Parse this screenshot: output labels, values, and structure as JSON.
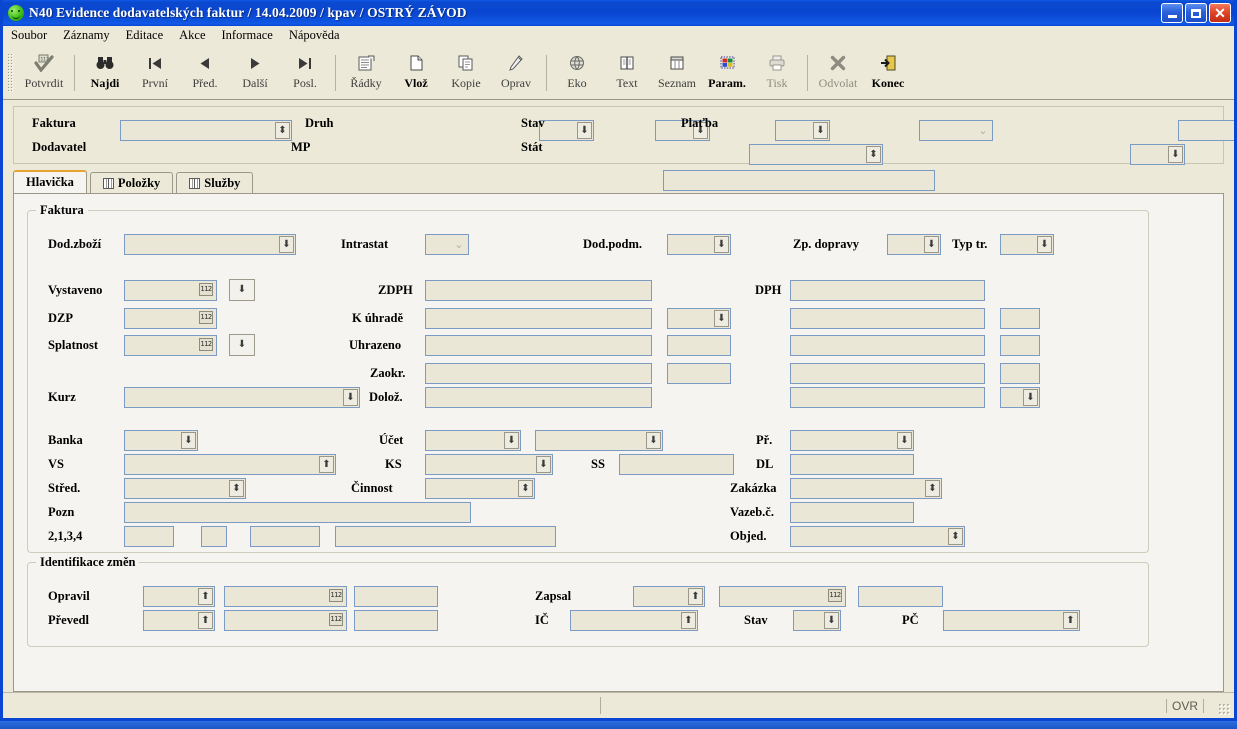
{
  "window": {
    "title": "N40 Evidence dodavatelských faktur / 14.04.2009 / kpav / OSTRÝ ZÁVOD",
    "icon": "smiley-icon",
    "minimize_label": "_",
    "maximize_label": "□",
    "close_label": "✕"
  },
  "menu": {
    "items": [
      {
        "label": "Soubor"
      },
      {
        "label": "Záznamy"
      },
      {
        "label": "Editace"
      },
      {
        "label": "Akce"
      },
      {
        "label": "Informace"
      },
      {
        "label": "Nápověda"
      }
    ]
  },
  "toolbar": {
    "items": [
      {
        "label": "Potvrdit",
        "icon": "check-stamp-icon",
        "state": "normal"
      },
      {
        "label": "Najdi",
        "icon": "binoculars-icon",
        "state": "bold"
      },
      {
        "label": "První",
        "icon": "first-record-icon",
        "state": "normal"
      },
      {
        "label": "Před.",
        "icon": "previous-record-icon",
        "state": "normal"
      },
      {
        "label": "Další",
        "icon": "next-record-icon",
        "state": "normal"
      },
      {
        "label": "Posl.",
        "icon": "last-record-icon",
        "state": "normal"
      },
      {
        "label": "Řádky",
        "icon": "lines-form-icon",
        "state": "normal"
      },
      {
        "label": "Vlož",
        "icon": "new-document-icon",
        "state": "bold"
      },
      {
        "label": "Kopie",
        "icon": "copy-icon",
        "state": "normal"
      },
      {
        "label": "Oprav",
        "icon": "pencil-edit-icon",
        "state": "normal"
      },
      {
        "label": "Eko",
        "icon": "eko-globe-icon",
        "state": "normal"
      },
      {
        "label": "Text",
        "icon": "text-book-icon",
        "state": "normal"
      },
      {
        "label": "Seznam",
        "icon": "list-columns-icon",
        "state": "normal"
      },
      {
        "label": "Param.",
        "icon": "parameters-color-icon",
        "state": "bold"
      },
      {
        "label": "Tisk",
        "icon": "printer-icon",
        "state": "dim"
      },
      {
        "label": "Odvolat",
        "icon": "cancel-x-icon",
        "state": "dim"
      },
      {
        "label": "Konec",
        "icon": "exit-door-icon",
        "state": "bold"
      }
    ]
  },
  "filter": {
    "faktura_label": "Faktura",
    "faktura_value": "",
    "dodavatel_label": "Dodavatel",
    "dodavatel_value": "",
    "druh_label": "Druh",
    "druh_values": [
      "",
      "",
      ""
    ],
    "mp_label": "MP",
    "mp_values": [
      "",
      ""
    ],
    "stav_label": "Stav",
    "stav_value": "",
    "stat_label": "Stát",
    "stat_value": "",
    "stat_note_value": "",
    "platba_label": "Plaťba",
    "platba_value": "",
    "platba_extra_value": ""
  },
  "tabs": [
    {
      "label": "Hlavička",
      "icon": "",
      "active": true
    },
    {
      "label": "Položky",
      "icon": "book-icon",
      "active": false
    },
    {
      "label": "Služby",
      "icon": "book-icon",
      "active": false
    }
  ],
  "faktura_group": {
    "title": "Faktura",
    "fields": {
      "dod_zbozi_label": "Dod.zboží",
      "dod_zbozi_value": "",
      "intrastat_label": "Intrastat",
      "intrastat_value": "",
      "dod_podm_label": "Dod.podm.",
      "dod_podm_value": "",
      "zp_dopravy_label": "Zp. dopravy",
      "zp_dopravy_value": "",
      "typ_tr_label": "Typ tr.",
      "typ_tr_value": "",
      "vystaveno_label": "Vystaveno",
      "vystaveno_value": "",
      "dzp_label": "DZP",
      "dzp_value": "",
      "splatnost_label": "Splatnost",
      "splatnost_value": "",
      "kurz_label": "Kurz",
      "kurz_value": "",
      "zdph_label": "ZDPH",
      "zdph_value": "",
      "k_uhrade_label": "K úhradě",
      "k_uhrade_value": "",
      "uhrazeno_label": "Uhrazeno",
      "uhrazeno_value": "",
      "zaokr_label": "Zaokr.",
      "zaokr_value": "",
      "doloz_label": "Dolož.",
      "doloz_value": "",
      "dph_label": "DPH",
      "dph_value": "",
      "banka_label": "Banka",
      "banka_value": "",
      "vs_label": "VS",
      "vs_value": "",
      "stred_label": "Střed.",
      "stred_value": "",
      "pozn_label": "Pozn",
      "pozn_value": "",
      "ctyri_label": "2,1,3,4",
      "ctyri_values": [
        "",
        "",
        "",
        ""
      ],
      "ucet_label": "Účet",
      "ucet_value": "",
      "ucet2_value": "",
      "ks_label": "KS",
      "ks_value": "",
      "ss_label": "SS",
      "ss_value": "",
      "cinnost_label": "Činnost",
      "cinnost_value": "",
      "pr_label": "Př.",
      "pr_value": "",
      "dl_label": "DL",
      "dl_value": "",
      "zakazka_label": "Zakázka",
      "zakazka_value": "",
      "vazeb_label": "Vazeb.č.",
      "vazeb_value": "",
      "objed_label": "Objed.",
      "objed_value": ""
    }
  },
  "identifikace_group": {
    "title": "Identifikace změn",
    "fields": {
      "opravil_label": "Opravil",
      "opravil_values": [
        "",
        "",
        ""
      ],
      "prevedl_label": "Převedl",
      "prevedl_values": [
        "",
        "",
        ""
      ],
      "zapsal_label": "Zapsal",
      "zapsal_values": [
        "",
        "",
        ""
      ],
      "ic_label": "IČ",
      "ic_value": "",
      "stav_label": "Stav",
      "stav_value": "",
      "pc_label": "PČ",
      "pc_value": ""
    }
  },
  "statusbar": {
    "left_text": "",
    "ovr_text": "OVR"
  },
  "colors": {
    "title_blue": "#0a46d2",
    "chrome": "#ece9d8",
    "pane": "#f5f4f0",
    "field_bg": "#eae7d6",
    "field_border": "#7b9ac4",
    "tab_accent": "#e8a433"
  }
}
